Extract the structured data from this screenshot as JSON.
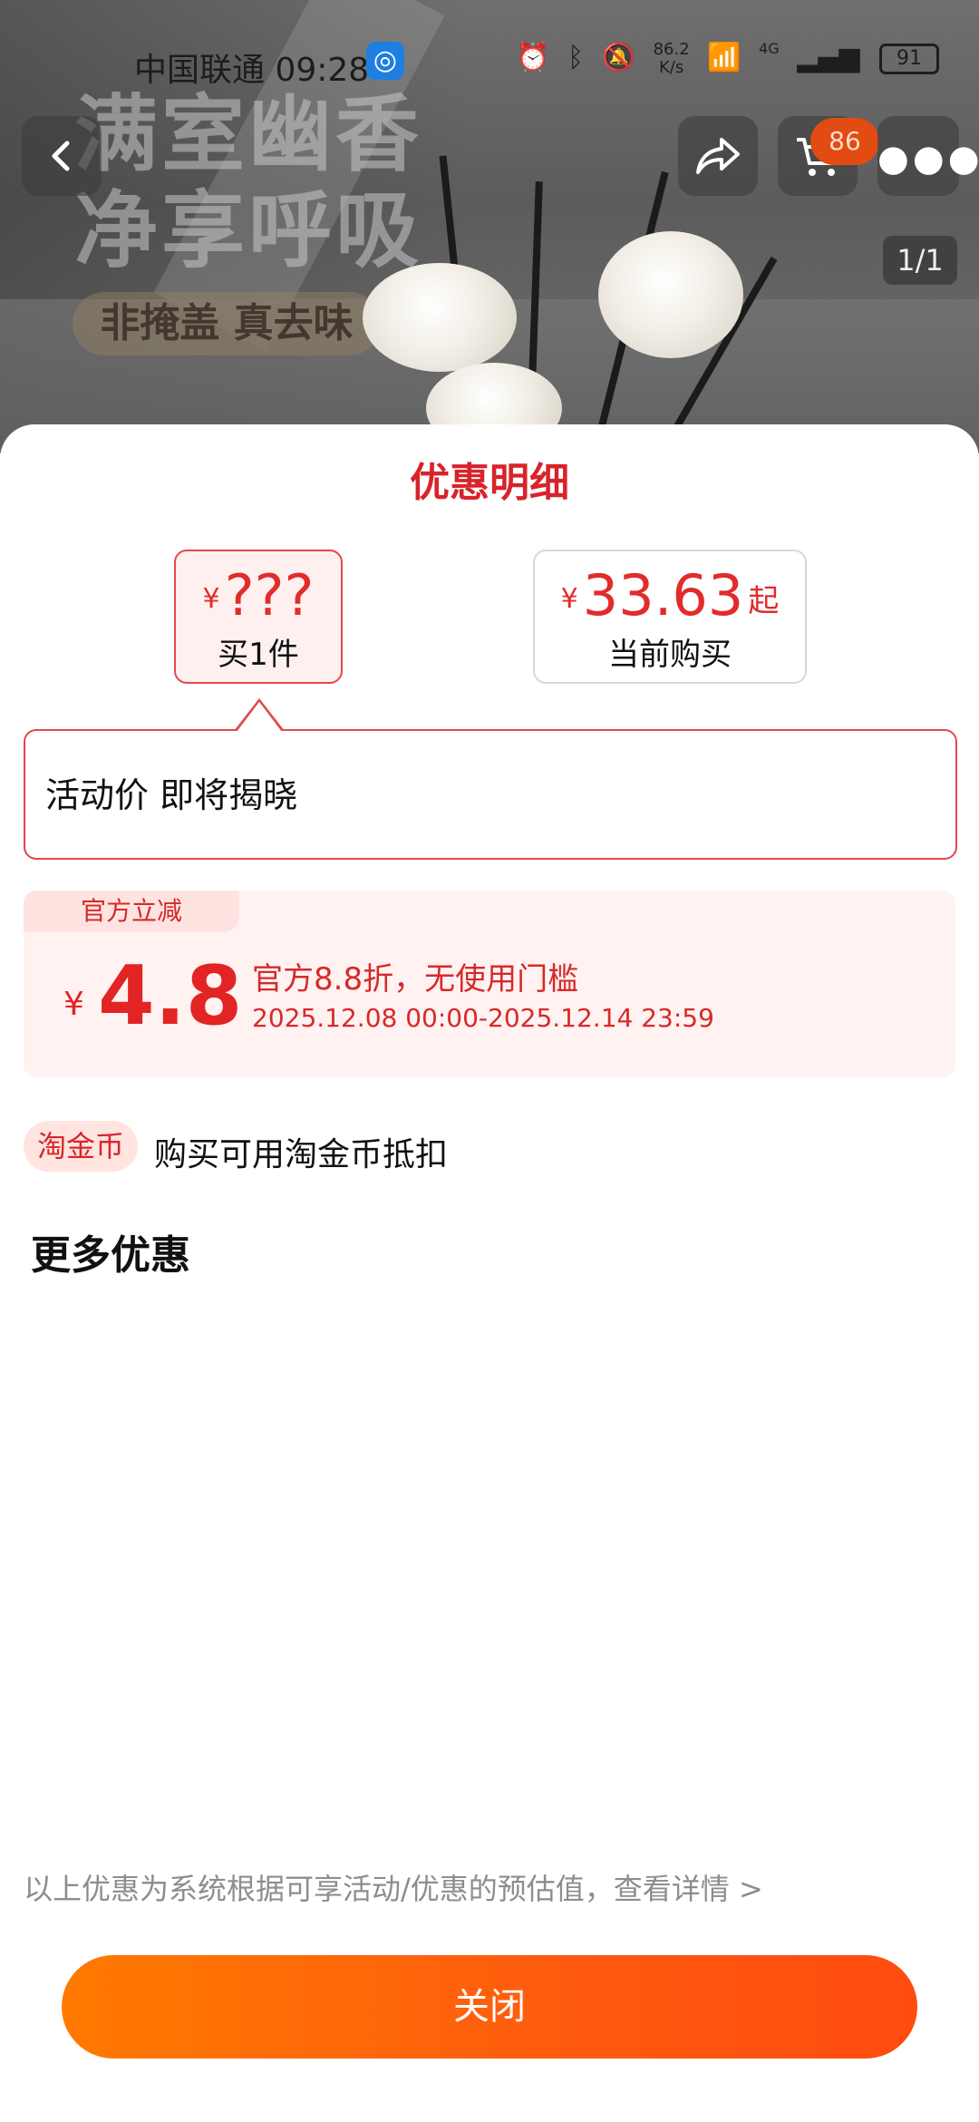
{
  "status_bar": {
    "carrier_time": "中国联通 09:28",
    "net_speed_value": "86.2",
    "net_speed_unit": "K/s",
    "network": "4G",
    "battery": "91"
  },
  "hero": {
    "headline_line1": "满室幽香",
    "headline_line2": "净享呼吸",
    "tagline": "非掩盖 真去味",
    "cart_badge": "86",
    "pager": "1/1"
  },
  "sheet": {
    "title": "优惠明细",
    "card_buy_one": {
      "yen": "¥",
      "price": "???",
      "label": "买1件"
    },
    "card_current": {
      "yen": "¥",
      "price": "33.63",
      "suffix": "起",
      "label": "当前购买"
    },
    "callout_text": "活动价 即将揭晓",
    "discount": {
      "tag": "官方立减",
      "yen": "¥",
      "amount": "4.8",
      "desc": "官方8.8折，无使用门槛",
      "dates": "2025.12.08 00:00-2025.12.14 23:59"
    },
    "coin": {
      "tag": "淘金币",
      "text": "购买可用淘金币抵扣"
    },
    "more_title": "更多优惠",
    "footnote": "以上优惠为系统根据可享活动/优惠的预估值，查看详情 >",
    "close_label": "关闭"
  },
  "colors": {
    "accent_red": "#e22b2b",
    "button_orange_start": "#ff7a00",
    "button_orange_end": "#ff4b10"
  }
}
